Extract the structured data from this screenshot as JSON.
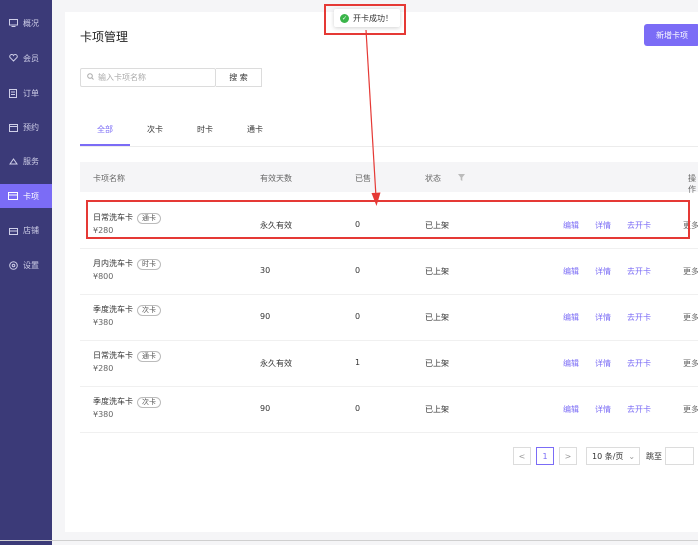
{
  "sidebar": {
    "items": [
      {
        "label": "概况",
        "icon": "monitor-icon"
      },
      {
        "label": "会员",
        "icon": "heart-icon"
      },
      {
        "label": "订单",
        "icon": "list-icon"
      },
      {
        "label": "预约",
        "icon": "calendar-icon"
      },
      {
        "label": "服务",
        "icon": "service-icon"
      },
      {
        "label": "卡项",
        "icon": "card-icon",
        "active": true
      },
      {
        "label": "店铺",
        "icon": "store-icon"
      },
      {
        "label": "设置",
        "icon": "gear-icon"
      }
    ]
  },
  "header": {
    "title": "卡项管理",
    "add_label": "新增卡项"
  },
  "search": {
    "placeholder": "输入卡项名称",
    "button_label": "搜 索"
  },
  "tabs": [
    {
      "label": "全部",
      "active": true
    },
    {
      "label": "次卡"
    },
    {
      "label": "时卡"
    },
    {
      "label": "通卡"
    }
  ],
  "table": {
    "columns": [
      "卡项名称",
      "有效天数",
      "已售",
      "状态",
      "操作"
    ],
    "rows": [
      {
        "name": "日常洗车卡",
        "tag": "通卡",
        "price": "¥280",
        "days": "永久有效",
        "sold": "0",
        "status": "已上架"
      },
      {
        "name": "月内洗车卡",
        "tag": "时卡",
        "price": "¥800",
        "days": "30",
        "sold": "0",
        "status": "已上架"
      },
      {
        "name": "季度洗车卡",
        "tag": "次卡",
        "price": "¥380",
        "days": "90",
        "sold": "0",
        "status": "已上架"
      },
      {
        "name": "日常洗车卡",
        "tag": "通卡",
        "price": "¥280",
        "days": "永久有效",
        "sold": "1",
        "status": "已上架"
      },
      {
        "name": "季度洗车卡",
        "tag": "次卡",
        "price": "¥380",
        "days": "90",
        "sold": "0",
        "status": "已上架"
      }
    ],
    "actions": {
      "edit": "编辑",
      "detail": "详情",
      "open": "去开卡",
      "more": "更多"
    }
  },
  "toast": {
    "message": "开卡成功！"
  },
  "pagination": {
    "prev": "<",
    "current": "1",
    "next": ">",
    "page_size": "10 条/页",
    "goto_label": "跳至"
  },
  "colors": {
    "accent": "#7b6cf6",
    "sidebar": "#3b3a78",
    "annotation": "#e53935",
    "success": "#3bb54a"
  }
}
